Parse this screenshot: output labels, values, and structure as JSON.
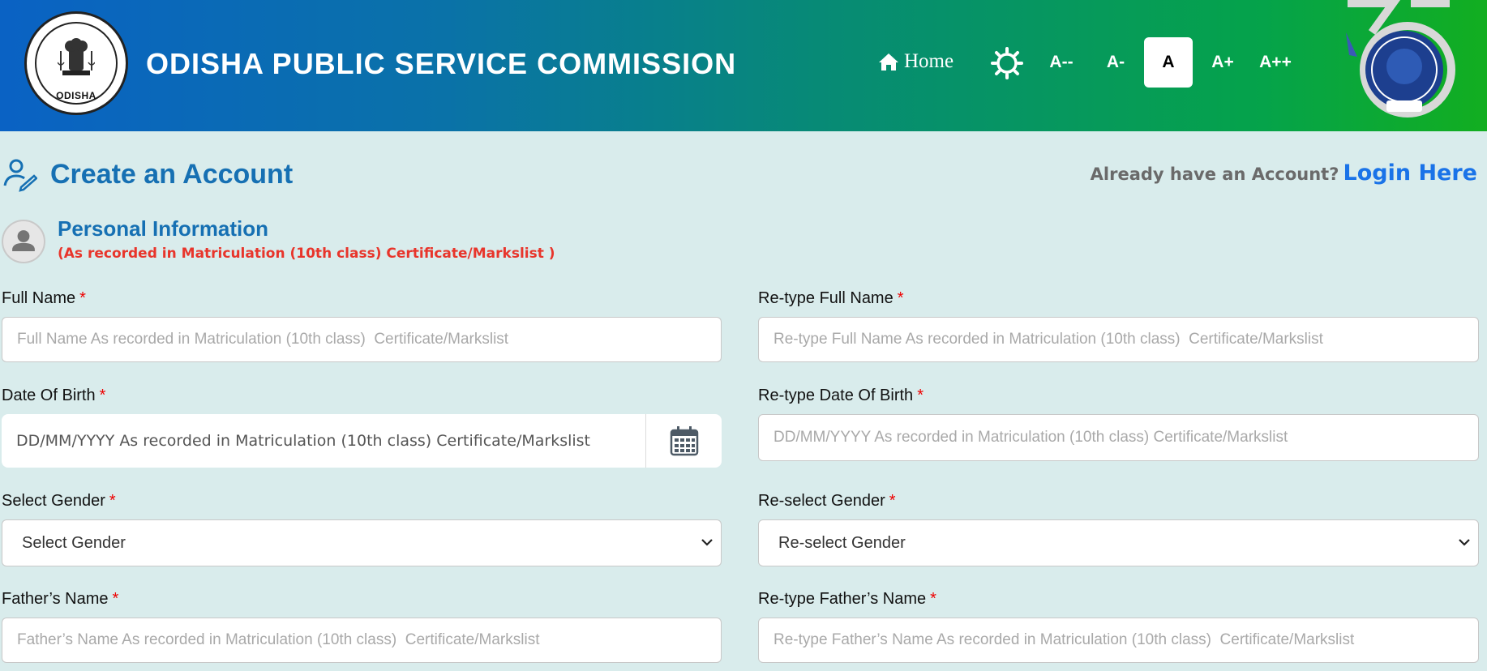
{
  "header": {
    "seal_label": "ODISHA",
    "title": "ODISHA PUBLIC SERVICE COMMISSION",
    "home_label": "Home",
    "font_sizes": [
      "A--",
      "A-",
      "A",
      "A+",
      "A++"
    ],
    "active_font_size": "A",
    "colors": {
      "gradient_start": "#0a62c4",
      "gradient_end": "#12ae20"
    }
  },
  "page": {
    "title": "Create an Account",
    "login_prompt": "Already have an Account?",
    "login_link": "Login Here"
  },
  "section": {
    "title": "Personal Information",
    "note": "(As recorded in Matriculation (10th class) Certificate/Markslist )"
  },
  "form": {
    "required_marker": "*",
    "full_name": {
      "label": "Full Name",
      "placeholder": "Full Name As recorded in Matriculation (10th class)  Certificate/Markslist"
    },
    "retype_full_name": {
      "label": "Re-type Full Name",
      "placeholder": "Re-type Full Name As recorded in Matriculation (10th class)  Certificate/Markslist"
    },
    "dob": {
      "label": "Date Of Birth",
      "placeholder": "DD/MM/YYYY As recorded in Matriculation (10th class) Certificate/Markslist"
    },
    "retype_dob": {
      "label": "Re-type Date Of Birth",
      "placeholder": "DD/MM/YYYY As recorded in Matriculation (10th class) Certificate/Markslist"
    },
    "gender": {
      "label": "Select Gender",
      "selected": "Select Gender"
    },
    "regender": {
      "label": "Re-select Gender",
      "selected": "Re-select Gender"
    },
    "father_name": {
      "label": "Father’s Name",
      "placeholder": "Father’s Name As recorded in Matriculation (10th class)  Certificate/Markslist"
    },
    "retype_father_name": {
      "label": "Re-type Father’s Name",
      "placeholder": "Re-type Father’s Name As recorded in Matriculation (10th class)  Certificate/Markslist"
    }
  },
  "icons": [
    "home-icon",
    "theme-toggle-icon",
    "user-edit-icon",
    "user-avatar-icon",
    "calendar-icon",
    "chevron-down-icon"
  ]
}
